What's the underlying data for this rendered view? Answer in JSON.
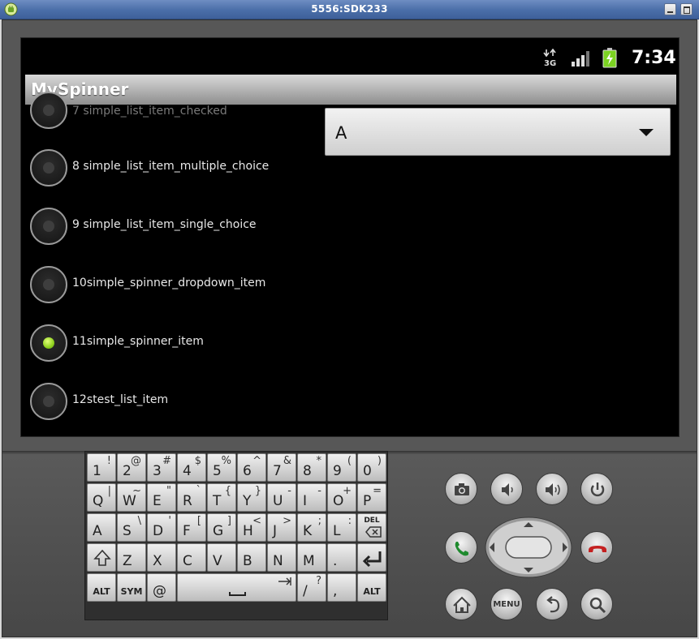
{
  "window": {
    "title": "5556:SDK233"
  },
  "status": {
    "network": "3G",
    "time": "7:34"
  },
  "app": {
    "title": "MySpinner"
  },
  "list": {
    "items": [
      {
        "label": "7 simple_list_item_checked",
        "checked": false,
        "faded": true
      },
      {
        "label": "8 simple_list_item_multiple_choice",
        "checked": false,
        "faded": false
      },
      {
        "label": "9 simple_list_item_single_choice",
        "checked": false,
        "faded": false
      },
      {
        "label": "10simple_spinner_dropdown_item",
        "checked": false,
        "faded": false
      },
      {
        "label": "11simple_spinner_item",
        "checked": true,
        "faded": false
      },
      {
        "label": "12stest_list_item",
        "checked": false,
        "faded": false
      }
    ]
  },
  "spinner": {
    "value": "A"
  },
  "keyboard": {
    "rows": [
      [
        {
          "main": "1",
          "alt": "!"
        },
        {
          "main": "2",
          "alt": "@"
        },
        {
          "main": "3",
          "alt": "#"
        },
        {
          "main": "4",
          "alt": "$"
        },
        {
          "main": "5",
          "alt": "%"
        },
        {
          "main": "6",
          "alt": "^"
        },
        {
          "main": "7",
          "alt": "&"
        },
        {
          "main": "8",
          "alt": "*"
        },
        {
          "main": "9",
          "alt": "("
        },
        {
          "main": "0",
          "alt": ")"
        }
      ],
      [
        {
          "main": "Q",
          "alt": "|"
        },
        {
          "main": "W",
          "alt": "~"
        },
        {
          "main": "E",
          "alt": "\""
        },
        {
          "main": "R",
          "alt": "`"
        },
        {
          "main": "T",
          "alt": "{"
        },
        {
          "main": "Y",
          "alt": "}"
        },
        {
          "main": "U",
          "alt": "-"
        },
        {
          "main": "I",
          "alt": "-"
        },
        {
          "main": "O",
          "alt": "+"
        },
        {
          "main": "P",
          "alt": "="
        }
      ],
      [
        {
          "main": "A",
          "alt": ""
        },
        {
          "main": "S",
          "alt": "\\"
        },
        {
          "main": "D",
          "alt": "'"
        },
        {
          "main": "F",
          "alt": "["
        },
        {
          "main": "G",
          "alt": "]"
        },
        {
          "main": "H",
          "alt": "<"
        },
        {
          "main": "J",
          "alt": ">"
        },
        {
          "main": "K",
          "alt": ";"
        },
        {
          "main": "L",
          "alt": ":"
        },
        {
          "main": "DEL",
          "alt": ""
        }
      ],
      [
        {
          "main": "",
          "alt": ""
        },
        {
          "main": "Z",
          "alt": ""
        },
        {
          "main": "X",
          "alt": ""
        },
        {
          "main": "C",
          "alt": ""
        },
        {
          "main": "V",
          "alt": ""
        },
        {
          "main": "B",
          "alt": ""
        },
        {
          "main": "N",
          "alt": ""
        },
        {
          "main": "M",
          "alt": ""
        },
        {
          "main": ".",
          "alt": ""
        },
        {
          "main": "",
          "alt": ""
        }
      ]
    ],
    "bottom": {
      "alt_left": "ALT",
      "sym": "SYM",
      "at": "@",
      "slash": "/",
      "slash_alt": "?",
      "comma": ",",
      "alt_right": "ALT"
    }
  },
  "hardware": {
    "menu_label": "MENU"
  },
  "colors": {
    "radio_checked": "#8fd11e",
    "battery": "#7cd322",
    "call_green": "#1f8a2e",
    "end_red": "#c42020"
  }
}
